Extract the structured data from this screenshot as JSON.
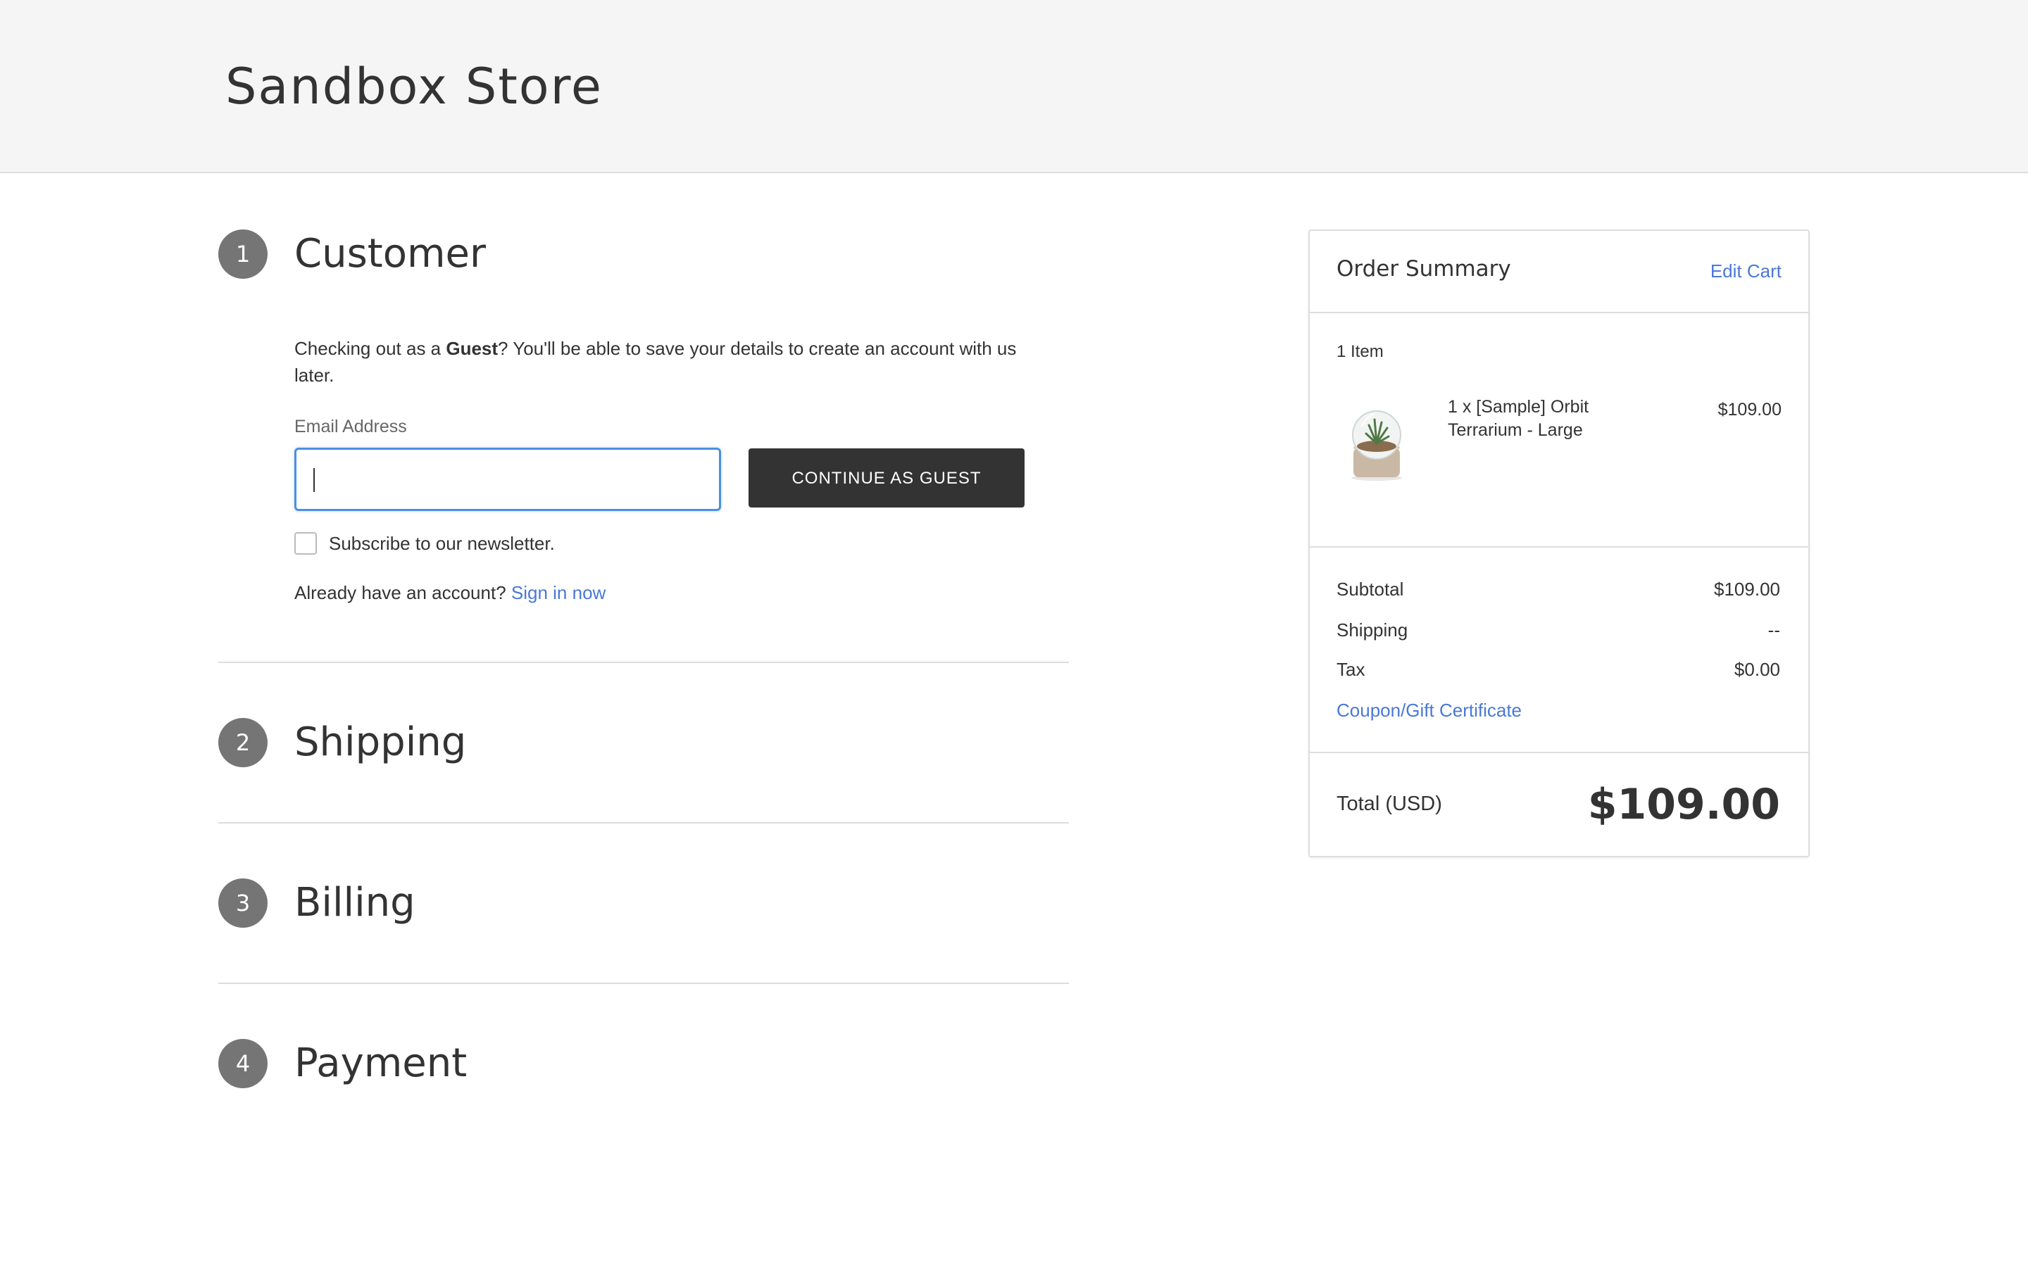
{
  "header": {
    "store_title": "Sandbox Store"
  },
  "steps": [
    {
      "number": "1",
      "title": "Customer"
    },
    {
      "number": "2",
      "title": "Shipping"
    },
    {
      "number": "3",
      "title": "Billing"
    },
    {
      "number": "4",
      "title": "Payment"
    }
  ],
  "customer": {
    "guest_prefix": "Checking out as a ",
    "guest_bold": "Guest",
    "guest_suffix": "? You'll be able to save your details to create an account with us later.",
    "email_label": "Email Address",
    "email_value": "",
    "continue_label": "CONTINUE AS GUEST",
    "newsletter_label": "Subscribe to our newsletter.",
    "newsletter_checked": false,
    "signin_prompt": "Already have an account?",
    "signin_link": "Sign in now"
  },
  "summary": {
    "title": "Order Summary",
    "edit_cart": "Edit Cart",
    "item_count": "1 Item",
    "items": [
      {
        "name": "1 x [Sample] Orbit Terrarium - Large",
        "price": "$109.00",
        "image_icon": "terrarium-product-image"
      }
    ],
    "subtotal_label": "Subtotal",
    "subtotal_value": "$109.00",
    "shipping_label": "Shipping",
    "shipping_value": "--",
    "tax_label": "Tax",
    "tax_value": "$0.00",
    "coupon_link": "Coupon/Gift Certificate",
    "total_label": "Total (USD)",
    "total_value": "$109.00"
  },
  "colors": {
    "link": "#4a78d6",
    "step_badge": "#757575",
    "button": "#333333",
    "input_focus": "#4a90e2"
  }
}
